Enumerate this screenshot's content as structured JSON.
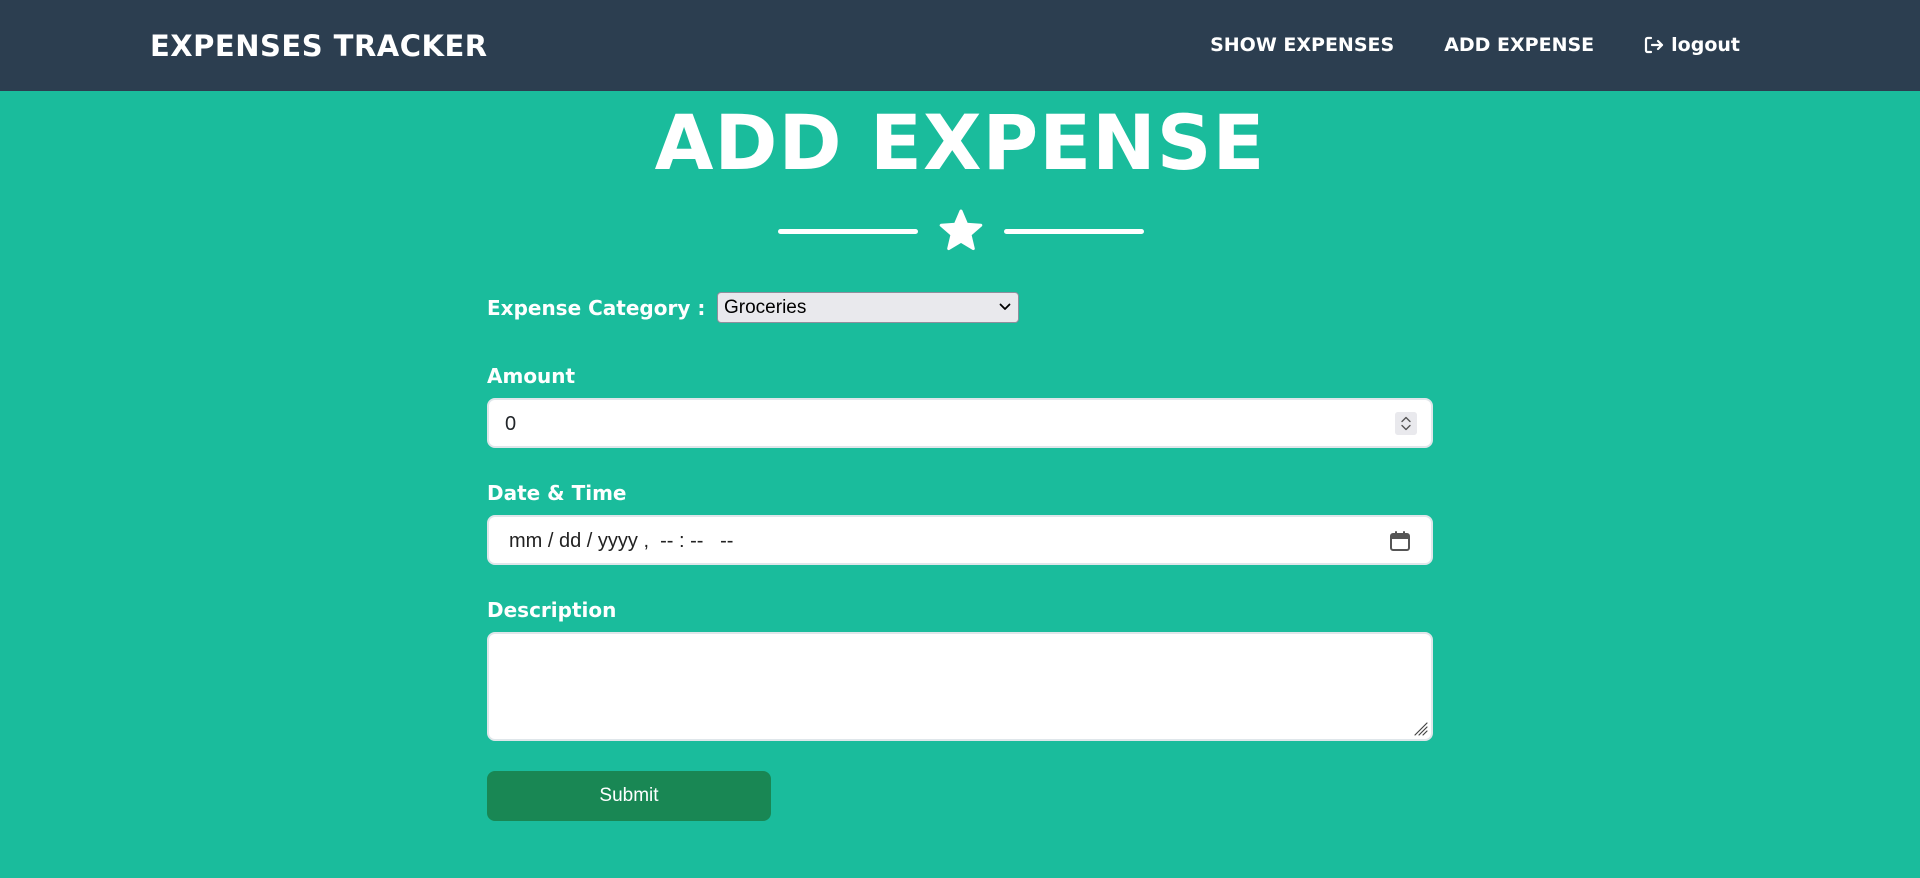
{
  "navbar": {
    "brand": "EXPENSES TRACKER",
    "links": {
      "show_expenses": "SHOW EXPENSES",
      "add_expense": "ADD EXPENSE",
      "logout": "logout"
    },
    "logout_icon": "sign-out-icon"
  },
  "page": {
    "title": "ADD EXPENSE",
    "divider_icon": "star-icon"
  },
  "form": {
    "category": {
      "label": "Expense Category :",
      "selected": "Groceries"
    },
    "amount": {
      "label": "Amount",
      "value": "0"
    },
    "datetime": {
      "label": "Date & Time",
      "placeholder": "mm / dd / yyyy ,  -- : --   --"
    },
    "description": {
      "label": "Description",
      "value": ""
    },
    "submit_label": "Submit"
  },
  "colors": {
    "background": "#1abc9c",
    "navbar": "#2c3e50",
    "submit": "#198754"
  }
}
